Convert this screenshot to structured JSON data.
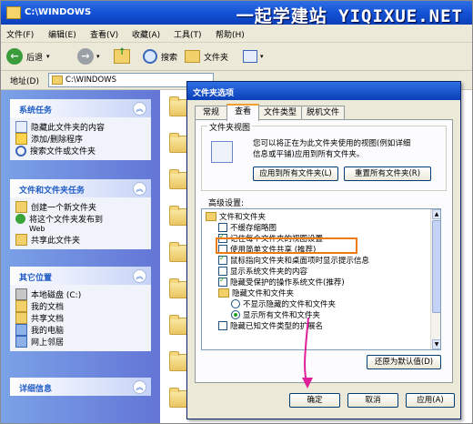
{
  "window": {
    "title": "C:\\WINDOWS",
    "watermark": "一起学建站 YIQIXUE.NET"
  },
  "menu": [
    "文件(F)",
    "编辑(E)",
    "查看(V)",
    "收藏(A)",
    "工具(T)",
    "帮助(H)"
  ],
  "toolbar": {
    "back": "后退",
    "search": "搜索",
    "folders": "文件夹"
  },
  "address": {
    "label": "地址(D)",
    "value": "C:\\WINDOWS"
  },
  "left_panels": {
    "system_tasks": {
      "title": "系统任务",
      "items": [
        "隐藏此文件夹的内容",
        "添加/删除程序",
        "搜索文件或文件夹"
      ]
    },
    "file_tasks": {
      "title": "文件和文件夹任务",
      "items": [
        "创建一个新文件夹",
        "将这个文件夹发布到",
        "Web",
        "共享此文件夹"
      ]
    },
    "other_places": {
      "title": "其它位置",
      "items": [
        "本地磁盘 (C:)",
        "我的文档",
        "共享文档",
        "我的电脑",
        "网上邻居"
      ]
    },
    "details": {
      "title": "详细信息"
    }
  },
  "dialog": {
    "title": "文件夹选项",
    "tabs": [
      "常规",
      "查看",
      "文件类型",
      "脱机文件"
    ],
    "folder_views": {
      "label": "文件夹视图",
      "desc1": "您可以将正在为此文件夹使用的视图(例如详细",
      "desc2": "信息或平铺)应用到所有文件夹。",
      "apply_all": "应用到所有文件夹(L)",
      "reset_all": "重置所有文件夹(R)"
    },
    "advanced": {
      "label": "高级设置:",
      "rows": [
        "文件和文件夹",
        "不缓存缩略图",
        "记住每个文件夹的视图设置",
        "使用简单文件共享 (推荐)",
        "鼠标指向文件夹和桌面项时显示提示信息",
        "显示系统文件夹的内容",
        "隐藏受保护的操作系统文件(推荐)",
        "隐藏文件和文件夹",
        "不显示隐藏的文件和文件夹",
        "显示所有文件和文件夹",
        "隐藏已知文件类型的扩展名"
      ]
    },
    "restore_defaults": "还原为默认值(D)",
    "ok": "确定",
    "cancel": "取消",
    "apply": "应用(A)"
  }
}
